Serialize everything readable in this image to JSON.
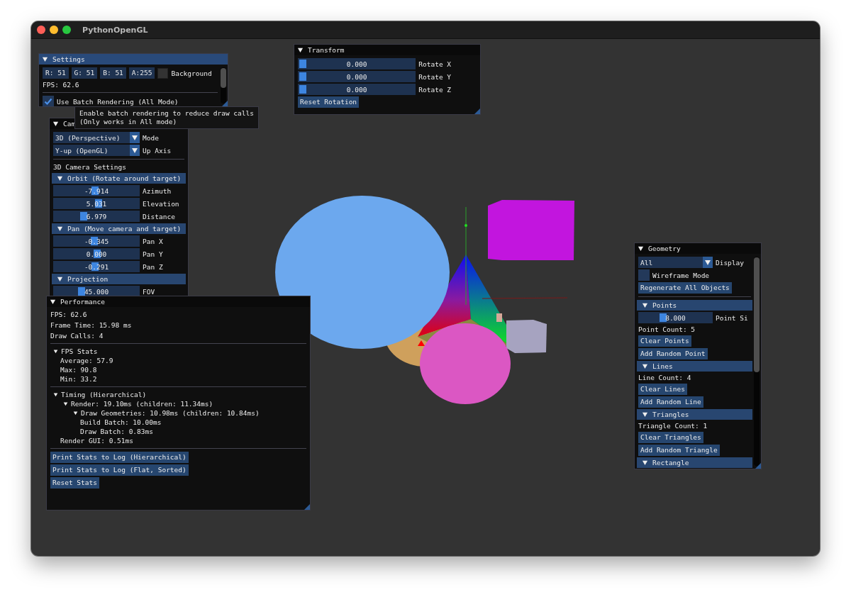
{
  "window": {
    "title": "PythonOpenGL"
  },
  "panels": [
    {
      "title": "Settings",
      "focused": true,
      "expanded": true,
      "items": [
        {
          "kind": "color_edit",
          "fields": [
            "R: 51",
            "G: 51",
            "B: 51",
            "A:255"
          ],
          "color": "#333333",
          "label": "Background"
        },
        {
          "kind": "text",
          "text": "FPS: 62.6"
        },
        {
          "kind": "separator"
        },
        {
          "kind": "checkbox",
          "label": "Use Batch Rendering (All Mode)",
          "checked": true
        }
      ]
    },
    {
      "title": "Transform",
      "focused": false,
      "expanded": true,
      "items": [
        {
          "kind": "slider",
          "number": "0.000",
          "label": "Rotate X",
          "level": 0
        },
        {
          "kind": "slider",
          "number": "0.000",
          "label": "Rotate Y",
          "level": 0
        },
        {
          "kind": "slider",
          "number": "0.000",
          "label": "Rotate Z",
          "level": 0
        },
        {
          "kind": "button",
          "label": "Reset Rotation"
        }
      ]
    },
    {
      "title": "Cam",
      "focused": false,
      "expanded": true,
      "items": [
        {
          "kind": "combo",
          "selection": "3D (Perspective)",
          "label": "Mode"
        },
        {
          "kind": "combo",
          "selection": "Y-up (OpenGL)",
          "label": "Up Axis"
        },
        {
          "kind": "separator"
        },
        {
          "kind": "text",
          "text": "3D Camera Settings"
        },
        {
          "kind": "header",
          "label": "Orbit (Rotate around target)",
          "expanded": true
        },
        {
          "kind": "slider",
          "number": "-7.914",
          "label": "Azimuth",
          "level": 0.47
        },
        {
          "kind": "slider",
          "number": "5.031",
          "label": "Elevation",
          "level": 0.52
        },
        {
          "kind": "slider",
          "number": "6.979",
          "label": "Distance",
          "level": 0.33
        },
        {
          "kind": "header",
          "label": "Pan (Move camera and target)",
          "expanded": true
        },
        {
          "kind": "slider",
          "number": "-0.345",
          "label": "Pan X",
          "level": 0.46
        },
        {
          "kind": "slider",
          "number": "0.000",
          "label": "Pan Y",
          "level": 0.5
        },
        {
          "kind": "slider",
          "number": "-0.291",
          "label": "Pan Z",
          "level": 0.47
        },
        {
          "kind": "header",
          "label": "Projection",
          "expanded": true
        },
        {
          "kind": "slider",
          "number": "45.000",
          "label": "FOV",
          "level": 0.3
        }
      ]
    },
    {
      "title": "Performance",
      "focused": false,
      "expanded": true,
      "items": [
        {
          "kind": "text",
          "text": "FPS: 62.6"
        },
        {
          "kind": "text",
          "text": "Frame Time: 15.98 ms"
        },
        {
          "kind": "text",
          "text": "Draw Calls: 4"
        },
        {
          "kind": "separator"
        },
        {
          "kind": "tree",
          "label": "FPS Stats",
          "expanded": true,
          "children": [
            {
              "kind": "text",
              "text": "Average: 57.9"
            },
            {
              "kind": "text",
              "text": "Max: 90.8"
            },
            {
              "kind": "text",
              "text": "Min: 33.2"
            }
          ]
        },
        {
          "kind": "separator"
        },
        {
          "kind": "tree",
          "label": "Timing (Hierarchical)",
          "expanded": true,
          "children": [
            {
              "kind": "tree",
              "label": "Render: 19.10ms (children: 11.34ms)",
              "expanded": true,
              "children": [
                {
                  "kind": "tree",
                  "label": "Draw Geometries: 10.98ms (children: 10.84ms)",
                  "expanded": true,
                  "children": [
                    {
                      "kind": "text",
                      "text": "Build Batch: 10.00ms"
                    },
                    {
                      "kind": "text",
                      "text": "Draw Batch: 0.83ms"
                    }
                  ]
                }
              ]
            },
            {
              "kind": "text",
              "text": "Render GUI: 0.51ms"
            }
          ]
        },
        {
          "kind": "separator"
        },
        {
          "kind": "button",
          "label": "Print Stats to Log (Hierarchical)"
        },
        {
          "kind": "button",
          "label": "Print Stats to Log (Flat, Sorted)"
        },
        {
          "kind": "button",
          "label": "Reset Stats"
        }
      ]
    },
    {
      "title": "Geometry",
      "focused": false,
      "expanded": true,
      "items": [
        {
          "kind": "combo",
          "selection": "All",
          "label": "Display"
        },
        {
          "kind": "checkbox",
          "label": "Wireframe Mode",
          "checked": false
        },
        {
          "kind": "button",
          "label": "Regenerate All Objects"
        },
        {
          "kind": "separator"
        },
        {
          "kind": "header",
          "label": "Points",
          "expanded": true
        },
        {
          "kind": "slider",
          "number": "8.000",
          "label": "Point Si",
          "level": 0.3
        },
        {
          "kind": "text",
          "text": "Point Count: 5"
        },
        {
          "kind": "button",
          "label": "Clear Points"
        },
        {
          "kind": "button",
          "label": "Add Random Point"
        },
        {
          "kind": "header",
          "label": "Lines",
          "expanded": true
        },
        {
          "kind": "text",
          "text": "Line Count: 4"
        },
        {
          "kind": "button",
          "label": "Clear Lines"
        },
        {
          "kind": "button",
          "label": "Add Random Line"
        },
        {
          "kind": "header",
          "label": "Triangles",
          "expanded": true
        },
        {
          "kind": "text",
          "text": "Triangle Count: 1"
        },
        {
          "kind": "button",
          "label": "Clear Triangles"
        },
        {
          "kind": "button",
          "label": "Add Random Triangle"
        },
        {
          "kind": "header",
          "label": "Rectangle",
          "expanded": true
        }
      ]
    }
  ],
  "tooltip": {
    "lines": [
      "Enable batch rendering to reduce draw calls",
      "(Only works in All mode)"
    ]
  }
}
